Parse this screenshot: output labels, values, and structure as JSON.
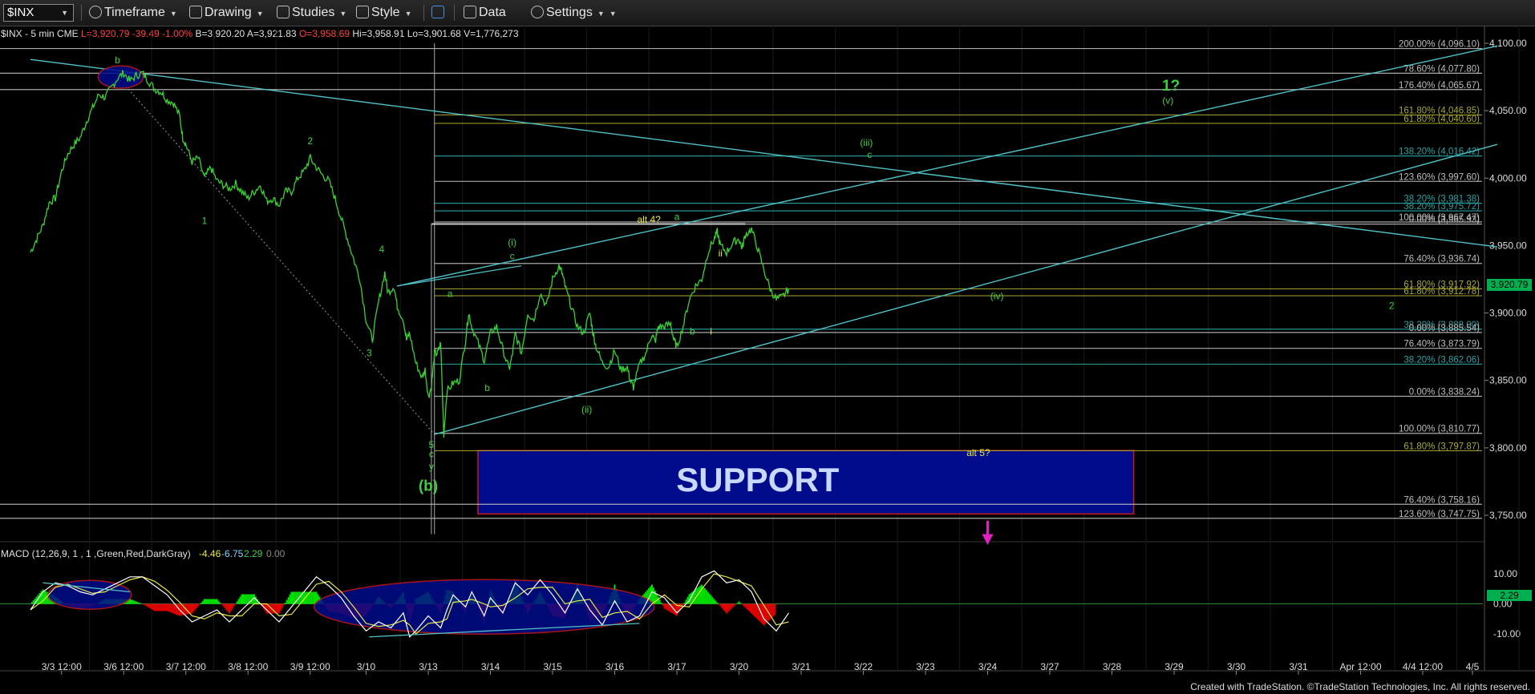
{
  "toolbar": {
    "symbol": "$INX",
    "items": [
      {
        "label": "Timeframe",
        "icon": "clock-icon"
      },
      {
        "label": "Drawing",
        "icon": "pencil-icon"
      },
      {
        "label": "Studies",
        "icon": "flask-icon"
      },
      {
        "label": "Style",
        "icon": "style-icon"
      },
      {
        "label": "",
        "icon": "panels-icon"
      },
      {
        "label": "Data",
        "icon": "bar-chart-icon"
      },
      {
        "label": "Settings",
        "icon": "gear-icon"
      }
    ]
  },
  "header": {
    "symbol_text": "$INX - 5 min  CME",
    "last": "L=3,920.79",
    "change": "-39.49",
    "pct": "-1.00%",
    "bid": "B=3,920.20",
    "ask": "A=3,921.83",
    "open": "O=3,958.69",
    "high": "Hi=3,958.91",
    "low": "Lo=3,901.68",
    "volume": "V=1,776,273"
  },
  "current_price_label": "3,920.79",
  "colors": {
    "price": "#39d431",
    "fib_gray": "#bdbdbd",
    "fib_olive": "#a8a832",
    "fib_teal": "#2aa3a3",
    "trend": "#4fc3c8",
    "support_fill": "#000c8c",
    "support_border": "#c41a1a",
    "wave_green": "#3fd040",
    "wave_yellow": "#e8e840",
    "arrow": "#e020c0"
  },
  "support_label": "SUPPORT",
  "macd": {
    "title": "MACD (12,26,9, 1 , 1 ,Green,Red,DarkGray)",
    "v1": "-4.46",
    "v2": "-6.75",
    "v3": "2.29",
    "v4": "0.00",
    "current": "2.29"
  },
  "footer": "Created with TradeStation. ©TradeStation Technologies, Inc. All rights reserved.",
  "chart_data": {
    "type": "line",
    "title": "$INX - 5 min",
    "y_axis": {
      "range": [
        3700,
        4110
      ],
      "ticks": [
        "4,100.00",
        "4,050.00",
        "4,000.00",
        "3,950.00",
        "3,900.00",
        "3,850.00",
        "3,800.00",
        "3,750.00"
      ]
    },
    "macd_axis": {
      "range": [
        -13,
        14
      ],
      "ticks": [
        "10.00",
        "0.00",
        "-10.00"
      ]
    },
    "x_ticks": [
      "3/3 12:00",
      "3/6 12:00",
      "3/7 12:00",
      "3/8 12:00",
      "3/9 12:00",
      "3/10",
      "3/13",
      "3/14",
      "3/15",
      "3/16",
      "3/17",
      "3/20",
      "3/21",
      "3/22",
      "3/23",
      "3/24",
      "3/27",
      "3/28",
      "3/29",
      "3/30",
      "3/31",
      "Apr 12:00",
      "4/4 12:00",
      "4/5"
    ],
    "x_ticks_idx": [
      0.5,
      1.5,
      2.5,
      3.5,
      4.5,
      5.4,
      6.4,
      7.4,
      8.4,
      9.4,
      10.4,
      11.4,
      12.4,
      13.4,
      14.4,
      15.4,
      16.4,
      17.4,
      18.4,
      19.4,
      20.4,
      21.4,
      22.4,
      23.2
    ],
    "price_series": [
      [
        0.0,
        3945
      ],
      [
        0.1,
        3955
      ],
      [
        0.2,
        3965
      ],
      [
        0.3,
        3982
      ],
      [
        0.4,
        3985
      ],
      [
        0.5,
        4005
      ],
      [
        0.6,
        4018
      ],
      [
        0.7,
        4025
      ],
      [
        0.8,
        4030
      ],
      [
        0.9,
        4042
      ],
      [
        1.0,
        4052
      ],
      [
        1.1,
        4062
      ],
      [
        1.2,
        4060
      ],
      [
        1.3,
        4067
      ],
      [
        1.4,
        4074
      ],
      [
        1.5,
        4078
      ],
      [
        1.6,
        4072
      ],
      [
        1.7,
        4076
      ],
      [
        1.8,
        4078
      ],
      [
        1.9,
        4072
      ],
      [
        2.0,
        4066
      ],
      [
        2.1,
        4064
      ],
      [
        2.2,
        4058
      ],
      [
        2.3,
        4056
      ],
      [
        2.4,
        4046
      ],
      [
        2.45,
        4030
      ],
      [
        2.5,
        4025
      ],
      [
        2.6,
        4012
      ],
      [
        2.7,
        4015
      ],
      [
        2.8,
        4000
      ],
      [
        2.9,
        4008
      ],
      [
        3.0,
        3998
      ],
      [
        3.1,
        3995
      ],
      [
        3.2,
        3992
      ],
      [
        3.3,
        3996
      ],
      [
        3.4,
        3990
      ],
      [
        3.5,
        3985
      ],
      [
        3.6,
        3990
      ],
      [
        3.7,
        3995
      ],
      [
        3.8,
        3983
      ],
      [
        3.9,
        3985
      ],
      [
        4.0,
        3980
      ],
      [
        4.1,
        3990
      ],
      [
        4.2,
        3990
      ],
      [
        4.3,
        4000
      ],
      [
        4.4,
        4005
      ],
      [
        4.5,
        4015
      ],
      [
        4.6,
        4008
      ],
      [
        4.7,
        4002
      ],
      [
        4.8,
        3998
      ],
      [
        4.9,
        3985
      ],
      [
        5.0,
        3970
      ],
      [
        5.1,
        3955
      ],
      [
        5.2,
        3940
      ],
      [
        5.3,
        3925
      ],
      [
        5.4,
        3895
      ],
      [
        5.5,
        3880
      ],
      [
        5.6,
        3908
      ],
      [
        5.7,
        3930
      ],
      [
        5.75,
        3915
      ],
      [
        5.85,
        3920
      ],
      [
        5.9,
        3905
      ],
      [
        6.0,
        3895
      ],
      [
        6.05,
        3880
      ],
      [
        6.1,
        3885
      ],
      [
        6.2,
        3863
      ],
      [
        6.3,
        3852
      ],
      [
        6.35,
        3858
      ],
      [
        6.4,
        3838
      ],
      [
        6.45,
        3845
      ],
      [
        6.5,
        3870
      ],
      [
        6.55,
        3870
      ],
      [
        6.6,
        3878
      ],
      [
        6.65,
        3810
      ],
      [
        6.7,
        3842
      ],
      [
        6.8,
        3848
      ],
      [
        6.9,
        3850
      ],
      [
        7.0,
        3880
      ],
      [
        7.05,
        3900
      ],
      [
        7.1,
        3890
      ],
      [
        7.2,
        3878
      ],
      [
        7.3,
        3865
      ],
      [
        7.4,
        3885
      ],
      [
        7.5,
        3890
      ],
      [
        7.6,
        3873
      ],
      [
        7.7,
        3858
      ],
      [
        7.75,
        3868
      ],
      [
        7.8,
        3885
      ],
      [
        7.9,
        3870
      ],
      [
        8.0,
        3900
      ],
      [
        8.1,
        3895
      ],
      [
        8.2,
        3915
      ],
      [
        8.3,
        3905
      ],
      [
        8.4,
        3925
      ],
      [
        8.5,
        3935
      ],
      [
        8.55,
        3930
      ],
      [
        8.6,
        3920
      ],
      [
        8.7,
        3905
      ],
      [
        8.8,
        3890
      ],
      [
        8.9,
        3885
      ],
      [
        9.0,
        3900
      ],
      [
        9.05,
        3885
      ],
      [
        9.1,
        3875
      ],
      [
        9.2,
        3863
      ],
      [
        9.3,
        3860
      ],
      [
        9.4,
        3872
      ],
      [
        9.5,
        3858
      ],
      [
        9.6,
        3860
      ],
      [
        9.65,
        3850
      ],
      [
        9.7,
        3845
      ],
      [
        9.8,
        3862
      ],
      [
        9.9,
        3870
      ],
      [
        10.0,
        3885
      ],
      [
        10.05,
        3878
      ],
      [
        10.1,
        3890
      ],
      [
        10.2,
        3890
      ],
      [
        10.3,
        3892
      ],
      [
        10.35,
        3880
      ],
      [
        10.4,
        3875
      ],
      [
        10.5,
        3890
      ],
      [
        10.6,
        3910
      ],
      [
        10.7,
        3920
      ],
      [
        10.8,
        3925
      ],
      [
        10.9,
        3945
      ],
      [
        11.0,
        3955
      ],
      [
        11.05,
        3960
      ],
      [
        11.1,
        3950
      ],
      [
        11.2,
        3945
      ],
      [
        11.3,
        3952
      ],
      [
        11.4,
        3955
      ],
      [
        11.45,
        3948
      ],
      [
        11.5,
        3958
      ],
      [
        11.6,
        3962
      ],
      [
        11.7,
        3948
      ],
      [
        11.8,
        3932
      ],
      [
        11.9,
        3918
      ],
      [
        12.0,
        3910
      ],
      [
        12.1,
        3912
      ],
      [
        12.2,
        3918
      ]
    ],
    "macd_series": [
      [
        0.0,
        -2
      ],
      [
        0.2,
        4
      ],
      [
        0.4,
        7
      ],
      [
        0.6,
        6
      ],
      [
        0.8,
        4
      ],
      [
        1.0,
        3
      ],
      [
        1.2,
        5
      ],
      [
        1.4,
        7
      ],
      [
        1.6,
        9
      ],
      [
        1.8,
        9
      ],
      [
        2.0,
        6
      ],
      [
        2.2,
        3
      ],
      [
        2.4,
        -2
      ],
      [
        2.6,
        -6
      ],
      [
        2.8,
        -4
      ],
      [
        3.0,
        -2
      ],
      [
        3.2,
        -6
      ],
      [
        3.4,
        -2
      ],
      [
        3.6,
        2
      ],
      [
        3.8,
        -2
      ],
      [
        4.0,
        -6
      ],
      [
        4.2,
        -1
      ],
      [
        4.4,
        4
      ],
      [
        4.6,
        9
      ],
      [
        4.8,
        6
      ],
      [
        5.0,
        2
      ],
      [
        5.2,
        -4
      ],
      [
        5.4,
        -9
      ],
      [
        5.6,
        -6
      ],
      [
        5.8,
        -8
      ],
      [
        6.0,
        -3
      ],
      [
        6.1,
        -11
      ],
      [
        6.2,
        -9
      ],
      [
        6.4,
        -4
      ],
      [
        6.6,
        -8
      ],
      [
        6.7,
        -2
      ],
      [
        6.8,
        3
      ],
      [
        7.0,
        -1
      ],
      [
        7.1,
        4
      ],
      [
        7.3,
        -4
      ],
      [
        7.4,
        2
      ],
      [
        7.6,
        -3
      ],
      [
        7.8,
        7
      ],
      [
        8.0,
        3
      ],
      [
        8.2,
        8
      ],
      [
        8.4,
        3
      ],
      [
        8.6,
        -3
      ],
      [
        8.8,
        5
      ],
      [
        9.0,
        -2
      ],
      [
        9.2,
        -7
      ],
      [
        9.4,
        1
      ],
      [
        9.6,
        -6
      ],
      [
        9.8,
        -4
      ],
      [
        10.0,
        4
      ],
      [
        10.2,
        2
      ],
      [
        10.4,
        -3
      ],
      [
        10.6,
        1
      ],
      [
        10.8,
        9
      ],
      [
        11.0,
        11
      ],
      [
        11.2,
        7
      ],
      [
        11.4,
        8
      ],
      [
        11.6,
        4
      ],
      [
        11.8,
        -5
      ],
      [
        12.0,
        -9
      ],
      [
        12.2,
        -3
      ]
    ],
    "horizontal_levels": [
      {
        "label": "200.00% (4,096.10)",
        "value": 4096.1,
        "color": "gray"
      },
      {
        "label": "78.60% (4,077.80)",
        "value": 4077.8,
        "color": "gray"
      },
      {
        "label": "176.40% (4,065.67)",
        "value": 4065.67,
        "color": "gray"
      },
      {
        "label": "161.80% (4,046.85)",
        "value": 4046.85,
        "color": "olive"
      },
      {
        "label": "61.80% (4,040.60)",
        "value": 4040.6,
        "color": "olive"
      },
      {
        "label": "138.20% (4,016.42)",
        "value": 4016.42,
        "color": "teal"
      },
      {
        "label": "123.60% (3,997.60)",
        "value": 3997.6,
        "color": "gray"
      },
      {
        "label": "38.20% (3,981.38)",
        "value": 3981.38,
        "color": "teal"
      },
      {
        "label": "38.20% (3,975.72)",
        "value": 3975.72,
        "color": "teal"
      },
      {
        "label": "100.00% (3,967.47)",
        "value": 3967.47,
        "color": "gray"
      },
      {
        "label": "0.00% (3,965.93)",
        "value": 3965.93,
        "color": "gray"
      },
      {
        "label": "76.40% (3,936.74)",
        "value": 3936.74,
        "color": "gray"
      },
      {
        "label": "61.80% (3,917.92)",
        "value": 3917.92,
        "color": "olive"
      },
      {
        "label": "61.80% (3,912.78)",
        "value": 3912.78,
        "color": "olive"
      },
      {
        "label": "38.20% (3,888.00)",
        "value": 3888.0,
        "color": "teal"
      },
      {
        "label": "0.00% (3,885.54)",
        "value": 3885.54,
        "color": "gray"
      },
      {
        "label": "76.40% (3,873.79)",
        "value": 3873.79,
        "color": "gray"
      },
      {
        "label": "38.20% (3,862.06)",
        "value": 3862.06,
        "color": "teal"
      },
      {
        "label": "0.00% (3,838.24)",
        "value": 3838.24,
        "color": "gray"
      },
      {
        "label": "100.00% (3,810.77)",
        "value": 3810.77,
        "color": "gray"
      },
      {
        "label": "61.80% (3,797.87)",
        "value": 3797.87,
        "color": "olive"
      },
      {
        "label": "76.40% (3,758.16)",
        "value": 3758.16,
        "color": "gray"
      },
      {
        "label": "123.60% (3,747.75)",
        "value": 3747.75,
        "color": "gray"
      }
    ],
    "wave_labels": [
      {
        "t": "b",
        "x": 1.4,
        "y": 4085,
        "c": "green"
      },
      {
        "t": "1",
        "x": 2.8,
        "y": 3966,
        "c": "green"
      },
      {
        "t": "2",
        "x": 4.5,
        "y": 4025,
        "c": "green"
      },
      {
        "t": "3",
        "x": 5.45,
        "y": 3868,
        "c": "green"
      },
      {
        "t": "4",
        "x": 5.65,
        "y": 3945,
        "c": "green"
      },
      {
        "t": "5",
        "x": 6.45,
        "y": 3800,
        "c": "green"
      },
      {
        "t": "c",
        "x": 6.45,
        "y": 3793,
        "c": "green"
      },
      {
        "t": "y",
        "x": 6.45,
        "y": 3784,
        "c": "green"
      },
      {
        "t": "(b)",
        "x": 6.4,
        "y": 3768,
        "c": "green"
      },
      {
        "t": "a",
        "x": 6.75,
        "y": 3912,
        "c": "green"
      },
      {
        "t": "b",
        "x": 7.35,
        "y": 3842,
        "c": "green"
      },
      {
        "t": "(i)",
        "x": 7.75,
        "y": 3950,
        "c": "green"
      },
      {
        "t": "c",
        "x": 7.75,
        "y": 3940,
        "c": "green"
      },
      {
        "t": "(ii)",
        "x": 8.95,
        "y": 3826,
        "c": "green"
      },
      {
        "t": "alt 4?",
        "x": 9.95,
        "y": 3967,
        "c": "yellow"
      },
      {
        "t": "a",
        "x": 10.4,
        "y": 3969,
        "c": "green"
      },
      {
        "t": "ii",
        "x": 11.1,
        "y": 3942,
        "c": "yellow"
      },
      {
        "t": "b",
        "x": 10.65,
        "y": 3884,
        "c": "green"
      },
      {
        "t": "i",
        "x": 10.95,
        "y": 3884,
        "c": "yellow"
      },
      {
        "t": "(iii)",
        "x": 13.45,
        "y": 4024,
        "c": "green"
      },
      {
        "t": "c",
        "x": 13.5,
        "y": 4015,
        "c": "green"
      },
      {
        "t": "(iv)",
        "x": 15.55,
        "y": 3910,
        "c": "green"
      },
      {
        "t": "1?",
        "x": 18.35,
        "y": 4065,
        "c": "green"
      },
      {
        "t": "(v)",
        "x": 18.3,
        "y": 4055,
        "c": "green"
      },
      {
        "t": "2",
        "x": 21.9,
        "y": 3903,
        "c": "green"
      },
      {
        "t": "alt 5?",
        "x": 15.25,
        "y": 3794,
        "c": "yellow"
      }
    ],
    "trend_lines": [
      {
        "x1": 0,
        "y1": 4088,
        "x2": 23.6,
        "y2": 3949
      },
      {
        "x1": 5.9,
        "y1": 3920,
        "x2": 23.6,
        "y2": 4098
      },
      {
        "x1": 6.5,
        "y1": 3810,
        "x2": 23.6,
        "y2": 4025
      }
    ],
    "support_zone": {
      "x1": 7.2,
      "x2": 17.75,
      "y1": 3798,
      "y2": 3751
    },
    "grid": false,
    "legend": "none"
  }
}
